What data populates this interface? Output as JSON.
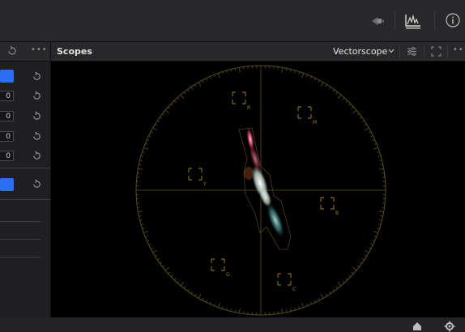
{
  "toolbar": {
    "icons": [
      "eyedropper-icon",
      "scopes-icon",
      "info-icon"
    ]
  },
  "scopes_panel": {
    "title": "Scopes",
    "scope_type": "Vectorscope",
    "header_icons": [
      "chevron-down-icon",
      "settings-sliders-icon",
      "expand-icon",
      "more-icon"
    ],
    "more_label": "•••"
  },
  "left_panel": {
    "more_label": "•••",
    "values": [
      "0",
      "0",
      "0",
      "0"
    ]
  },
  "vectorscope": {
    "targets": [
      "R",
      "M",
      "Y",
      "B",
      "G",
      "C"
    ],
    "graticule_color": "#7a6a2a",
    "target_color": "#b08820"
  },
  "bottom_bar": {
    "icons": [
      "home-icon",
      "gear-icon"
    ]
  }
}
